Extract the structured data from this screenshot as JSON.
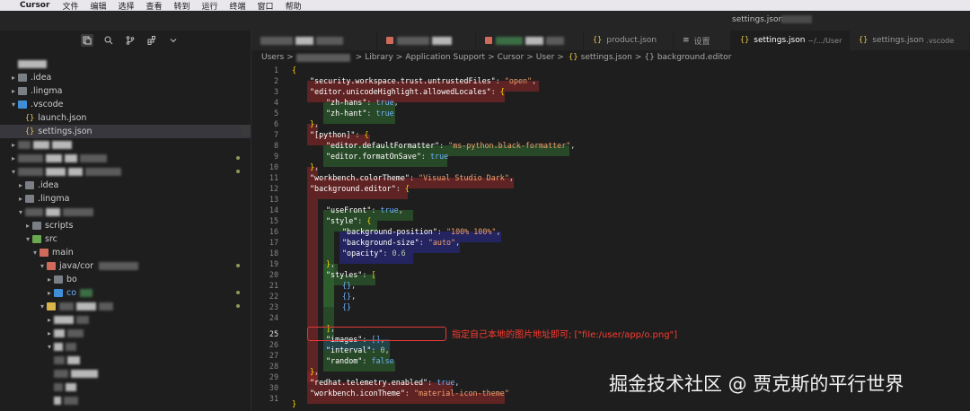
{
  "menubar": {
    "apple_glyph": "",
    "app_name": "Cursor",
    "items": [
      "文件",
      "编辑",
      "选择",
      "查看",
      "转到",
      "运行",
      "终端",
      "窗口",
      "帮助"
    ]
  },
  "window": {
    "title": "settings.json"
  },
  "sidebar": {
    "toolbar_icons": [
      "explorer-icon",
      "search-icon",
      "source-control-icon",
      "extensions-icon",
      "more-icon"
    ],
    "tree": {
      "idea": ".idea",
      "lingma": ".lingma",
      "vscode": ".vscode",
      "launch": "launch.json",
      "settings": "settings.json",
      "idea2": ".idea",
      "lingma2": ".lingma",
      "scripts": "scripts",
      "src": "src",
      "main": "main",
      "java": "java/cor",
      "bo": "bo",
      "co": "co"
    }
  },
  "tabs": {
    "product": "product.json",
    "settings_cn": "设置",
    "active_label": "settings.json",
    "active_path": "~/.../User",
    "last_label": "settings.json",
    "last_path": ".vscode"
  },
  "breadcrumb": {
    "start": "Users",
    "parts": [
      "Library",
      "Application Support",
      "Cursor",
      "User"
    ],
    "file": "settings.json",
    "symbol_glyph": "{}",
    "symbol": "background.editor",
    "sep": ">"
  },
  "editor": {
    "line_numbers": [
      "1",
      "2",
      "3",
      "4",
      "5",
      "6",
      "7",
      "8",
      "9",
      "10",
      "11",
      "12",
      "13",
      "14",
      "15",
      "16",
      "17",
      "18",
      "19",
      "20",
      "21",
      "22",
      "23",
      "24",
      "25",
      "26",
      "27",
      "28",
      "29",
      "30",
      "31"
    ],
    "tokens": {
      "open": "{",
      "close": "}",
      "k_trust": "\"security.workspace.trust.untrustedFiles\"",
      "v_open": "\"open\"",
      "k_locales": "\"editor.unicodeHighlight.allowedLocales\"",
      "k_zhhans": "\"zh-hans\"",
      "k_zhhant": "\"zh-hant\"",
      "v_true": "true",
      "v_false": "false",
      "k_python": "\"[python]\"",
      "k_formatter": "\"editor.defaultFormatter\"",
      "v_formatter": "\"ms-python.black-formatter\"",
      "k_fos": "\"editor.formatOnSave\"",
      "k_color": "\"workbench.colorTheme\"",
      "v_color": "\"Visual Studio Dark\"",
      "k_bg": "\"background.editor\"",
      "k_usefront": "\"useFront\"",
      "k_style": "\"style\"",
      "k_bgpos": "\"background-position\"",
      "v_bgpos": "\"100% 100%\"",
      "k_bgsize": "\"background-size\"",
      "v_bgsize": "\"auto\"",
      "k_opacity": "\"opacity\"",
      "v_opacity": "0.6",
      "k_styles": "\"styles\"",
      "k_images": "\"images\"",
      "k_interval": "\"interval\"",
      "v_interval": "0",
      "k_random": "\"random\"",
      "k_redhat": "\"redhat.telemetry.enabled\"",
      "k_icon": "\"workbench.iconTheme\"",
      "v_icon": "\"material-icon-theme\""
    }
  },
  "annotation": {
    "text": "指定自己本地的图片地址即可; [\"file:/user/app/o.png\"]",
    "color": "#ff3b30"
  },
  "watermark": "掘金技术社区 @ 贾克斯的平行世界",
  "colors": {
    "editor_bg": "#1e1e1e",
    "tab_bar": "#252526",
    "string": "#f0a070",
    "bracket": "#ffd700"
  }
}
